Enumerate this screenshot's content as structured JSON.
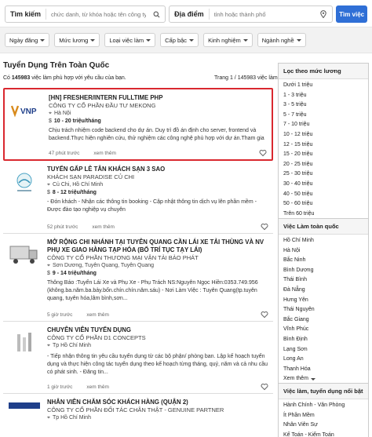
{
  "search": {
    "keyword_label": "Tìm kiếm",
    "keyword_placeholder": "chức danh, từ khóa hoặc tên công ty",
    "location_label": "Địa điểm",
    "location_placeholder": "tỉnh hoặc thành phố",
    "button_label": "Tìm việc"
  },
  "filters": [
    "Ngày đăng",
    "Mức lương",
    "Loại việc làm",
    "Cấp bậc",
    "Kinh nghiệm",
    "Ngành nghề"
  ],
  "page": {
    "heading": "Tuyển Dụng Trên Toàn Quốc",
    "summary_prefix": "Có",
    "total": "145983",
    "summary_suffix": "việc làm phù hợp với yêu cầu của bạn.",
    "page_info": "Trang 1 / 145983 việc làm"
  },
  "jobs": [
    {
      "title": "[HN] FRESHER/INTERN FULLTIME PHP",
      "company": "CÔNG TY CỔ PHẦN ĐẦU TƯ MEKONG",
      "location": "Hà Nội",
      "salary": "10 - 20 triệu/tháng",
      "desc": "Chịu trách nhiệm code backend cho dự án. Duy trì đồ án định cho server, frontend và backend.Thực hiện nghiên cứu, thử nghiệm các công nghệ phù hợp với dự án.Tham gia review...",
      "posted": "47 phút trước",
      "more": "xem thêm",
      "logo_text": "VNP"
    },
    {
      "title": "TUYỂN GẤP LỄ TÂN KHÁCH SẠN 3 SAO",
      "company": "KHÁCH SẠN PARADISE CỦ CHI",
      "location": "Củ Chi, Hồ Chí Minh",
      "salary": "8 - 12 triệu/tháng",
      "desc": "- Đón khách - Nhận các thông tin booking - Cập nhật thông tin dịch vụ lên phần mềm - Được đào tạo nghiệp vụ chuyên",
      "posted": "52 phút trước",
      "more": "xem thêm",
      "logo_text": ""
    },
    {
      "title": "MỞ RỘNG CHI NHÁNH TẠI TUYÊN QUANG CẦN LÁI XE TẢI THÙNG VÀ NV PHỤ XE GIAO HÀNG TẠP HÓA (BỐ TRÍ TỤC TẠY LÁI)",
      "company": "CÔNG TY CỔ PHẦN THƯƠNG MẠI VẬN TẢI BẢO PHÁT",
      "location": "Sơn Dương, Tuyên Quang, Tuyên Quang",
      "salary": "9 - 14 triệu/tháng",
      "desc": "Thông Báo :Tuyển Lái Xe và Phụ Xe - Phụ Trách NS:Nguyễn Ngọc Hiền:0353.749.956 (không.ba.năm.ba.bảy.bốn.chín.chín.năm.sáu) - Nơi Làm Việc : Tuyên Quang(tp.tuyên quang, tuyên hóa,lâm bình,sơn...",
      "posted": "5 giờ trước",
      "more": "xem thêm",
      "logo_text": ""
    },
    {
      "title": "CHUYÊN VIÊN TUYỂN DỤNG",
      "company": "CÔNG TY CỔ PHẦN D1 CONCEPTS",
      "location": "Tp Hồ Chí Minh",
      "salary": "",
      "desc": "- Tiếp nhận thông tin yêu cầu tuyển dụng từ các bộ phận/ phòng ban. Lập kế hoạch tuyển dụng và thực hiện công tác tuyển dụng theo kế hoạch từng tháng, quý, năm và cả nhu cầu có phát sinh. - Đăng tin...",
      "posted": "1 giờ trước",
      "more": "xem thêm",
      "logo_text": ""
    },
    {
      "title": "NHÂN VIÊN CHĂM SÓC KHÁCH HÀNG (QUẬN 2)",
      "company": "CÔNG TY CỔ PHẦN ĐỐI TÁC CHÂN THẬT - GENUINE PARTNER",
      "location": "Tp Hồ Chí Minh",
      "salary": "",
      "desc": "",
      "posted": "",
      "more": "",
      "logo_text": ""
    }
  ],
  "salary_filter": {
    "heading": "Lọc theo mức lương",
    "items": [
      "Dưới 1 triệu",
      "1 - 3 triệu",
      "3 - 5 triệu",
      "5 - 7 triệu",
      "7 - 10 triệu",
      "10 - 12 triệu",
      "12 - 15 triệu",
      "15 - 20 triệu",
      "20 - 25 triệu",
      "25 - 30 triệu",
      "30 - 40 triệu",
      "40 - 50 triệu",
      "50 - 60 triệu",
      "Trên 60 triệu"
    ]
  },
  "location_filter": {
    "heading": "Việc Làm toàn quốc",
    "items": [
      "Hồ Chí Minh",
      "Hà Nội",
      "Bắc Ninh",
      "Bình Dương",
      "Thái Bình",
      "Đà Nẵng",
      "Hưng Yên",
      "Thái Nguyên",
      "Bắc Giang",
      "Vĩnh Phúc",
      "Bình Định",
      "Lạng Sơn",
      "Long An",
      "Thanh Hóa"
    ],
    "more": "Xem thêm"
  },
  "featured": {
    "heading": "Việc làm, tuyển dụng nổi bật",
    "items": [
      "Hành Chính - Văn Phòng",
      "Ít Phần Mềm",
      "Nhân Viên Sự",
      "Kế Toán - Kiểm Toán"
    ]
  },
  "colors": {
    "accent": "#2f6fd6",
    "highlight": "#d9282f"
  }
}
